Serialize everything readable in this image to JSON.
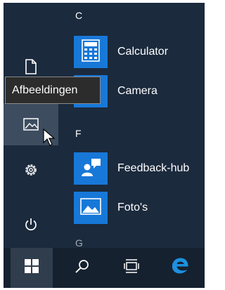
{
  "tooltip": {
    "text": "Afbeeldingen"
  },
  "sections": [
    {
      "letter": "C"
    },
    {
      "letter": "F"
    },
    {
      "letter": "G"
    }
  ],
  "apps": [
    {
      "label": "Calculator",
      "icon": "calculator-icon"
    },
    {
      "label": "Camera",
      "icon": "camera-icon"
    },
    {
      "label": "Feedback-hub",
      "icon": "feedback-hub-icon"
    },
    {
      "label": "Foto's",
      "icon": "photos-icon"
    }
  ],
  "rail": {
    "items": [
      {
        "name": "documents",
        "icon": "document-icon"
      },
      {
        "name": "pictures",
        "icon": "pictures-icon",
        "state": "hover"
      },
      {
        "name": "settings",
        "icon": "gear-icon"
      },
      {
        "name": "power",
        "icon": "power-icon"
      }
    ]
  },
  "taskbar": {
    "items": [
      {
        "name": "start",
        "icon": "windows-logo-icon",
        "state": "active"
      },
      {
        "name": "search",
        "icon": "search-icon"
      },
      {
        "name": "task-view",
        "icon": "task-view-icon"
      },
      {
        "name": "edge",
        "icon": "edge-icon"
      }
    ]
  },
  "colors": {
    "background": "#1b2a3d",
    "tile": "#1878d8",
    "taskbar": "#15212f",
    "hover": "#3d4d5f",
    "edge_blue": "#1e90e0"
  }
}
